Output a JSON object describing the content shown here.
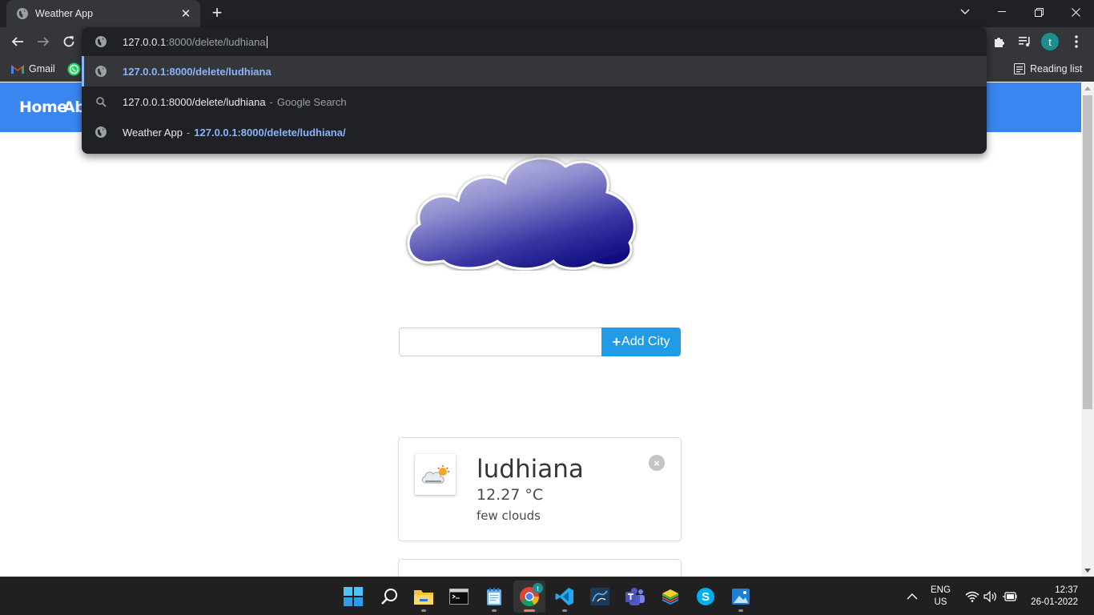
{
  "browser": {
    "tab": {
      "title": "Weather App"
    },
    "omnibox": {
      "typed_strong": "127.0.0.1",
      "typed_rest": ":8000/delete/ludhiana",
      "suggestions": [
        {
          "link": "127.0.0.1:8000/delete/ludhiana"
        },
        {
          "text": "127.0.0.1:8000/delete/ludhiana",
          "sep": "-",
          "sub": "Google Search"
        },
        {
          "text": "Weather App",
          "sep": "-",
          "link": "127.0.0.1:8000/delete/ludhiana/"
        }
      ]
    },
    "profile_initial": "t",
    "bookmarks": [
      {
        "label": "Gmail"
      }
    ],
    "reading_list": "Reading list"
  },
  "page": {
    "nav": {
      "home": "Home",
      "about": "Abo"
    },
    "search": {
      "value": "",
      "button_label": "Add City",
      "button_icon": "+"
    },
    "cities": [
      {
        "name": "ludhiana",
        "temp": "12.27 °C",
        "description": "few clouds",
        "icon": "few-clouds-icon",
        "delete_label": "×"
      }
    ]
  },
  "taskbar": {
    "lang_line1": "ENG",
    "lang_line2": "US",
    "time": "12:37",
    "date": "26-01-2022",
    "chrome_badge": "t"
  },
  "colors": {
    "nav": "#3a86f0",
    "button": "#1f9be8",
    "omnibox_bg": "#202124",
    "link": "#8ab4f8"
  }
}
